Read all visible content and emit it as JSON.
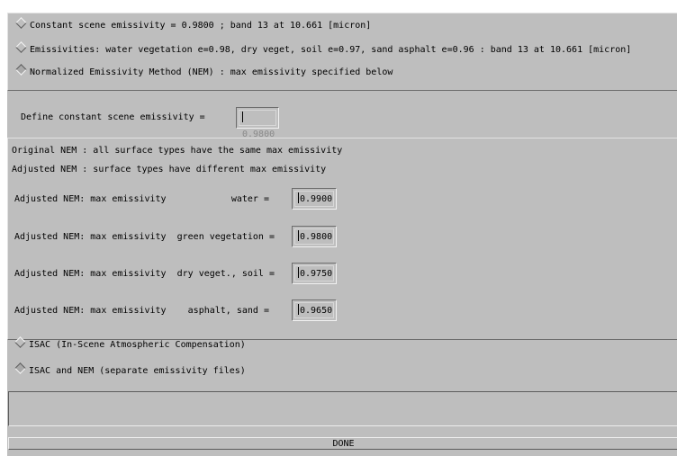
{
  "methods": {
    "options": [
      {
        "label": "Constant scene emissivity = 0.9800 ; band 13  at 10.661 [micron]",
        "selected": false
      },
      {
        "label": "Emissivities: water  vegetation e=0.98, dry veget,  soil e=0.97, sand  asphalt e=0.96 : band 13  at 10.661 [micron]",
        "selected": false
      },
      {
        "label": "Normalized Emissivity Method (NEM) : max emissivity specified below",
        "selected": true
      }
    ]
  },
  "constant": {
    "label": "Define constant scene emissivity =",
    "value": "0.9800"
  },
  "nem": {
    "note1": "Original NEM : all surface types have the same  max emissivity",
    "note2": "Adjusted NEM :     surface types have different max emissivity",
    "rows": [
      {
        "label": "Adjusted NEM: max emissivity            water =",
        "value": "0.9900"
      },
      {
        "label": "Adjusted NEM: max emissivity  green vegetation =",
        "value": "0.9800"
      },
      {
        "label": "Adjusted NEM: max emissivity  dry veget., soil =",
        "value": "0.9750"
      },
      {
        "label": "Adjusted NEM: max emissivity    asphalt, sand =",
        "value": "0.9650"
      }
    ]
  },
  "isac": {
    "options": [
      {
        "label": "ISAC (In-Scene Atmospheric Compensation)",
        "selected": false
      },
      {
        "label": "ISAC  and  NEM (separate emissivity files)",
        "selected": true
      }
    ]
  },
  "message": "",
  "done_label": "DONE"
}
